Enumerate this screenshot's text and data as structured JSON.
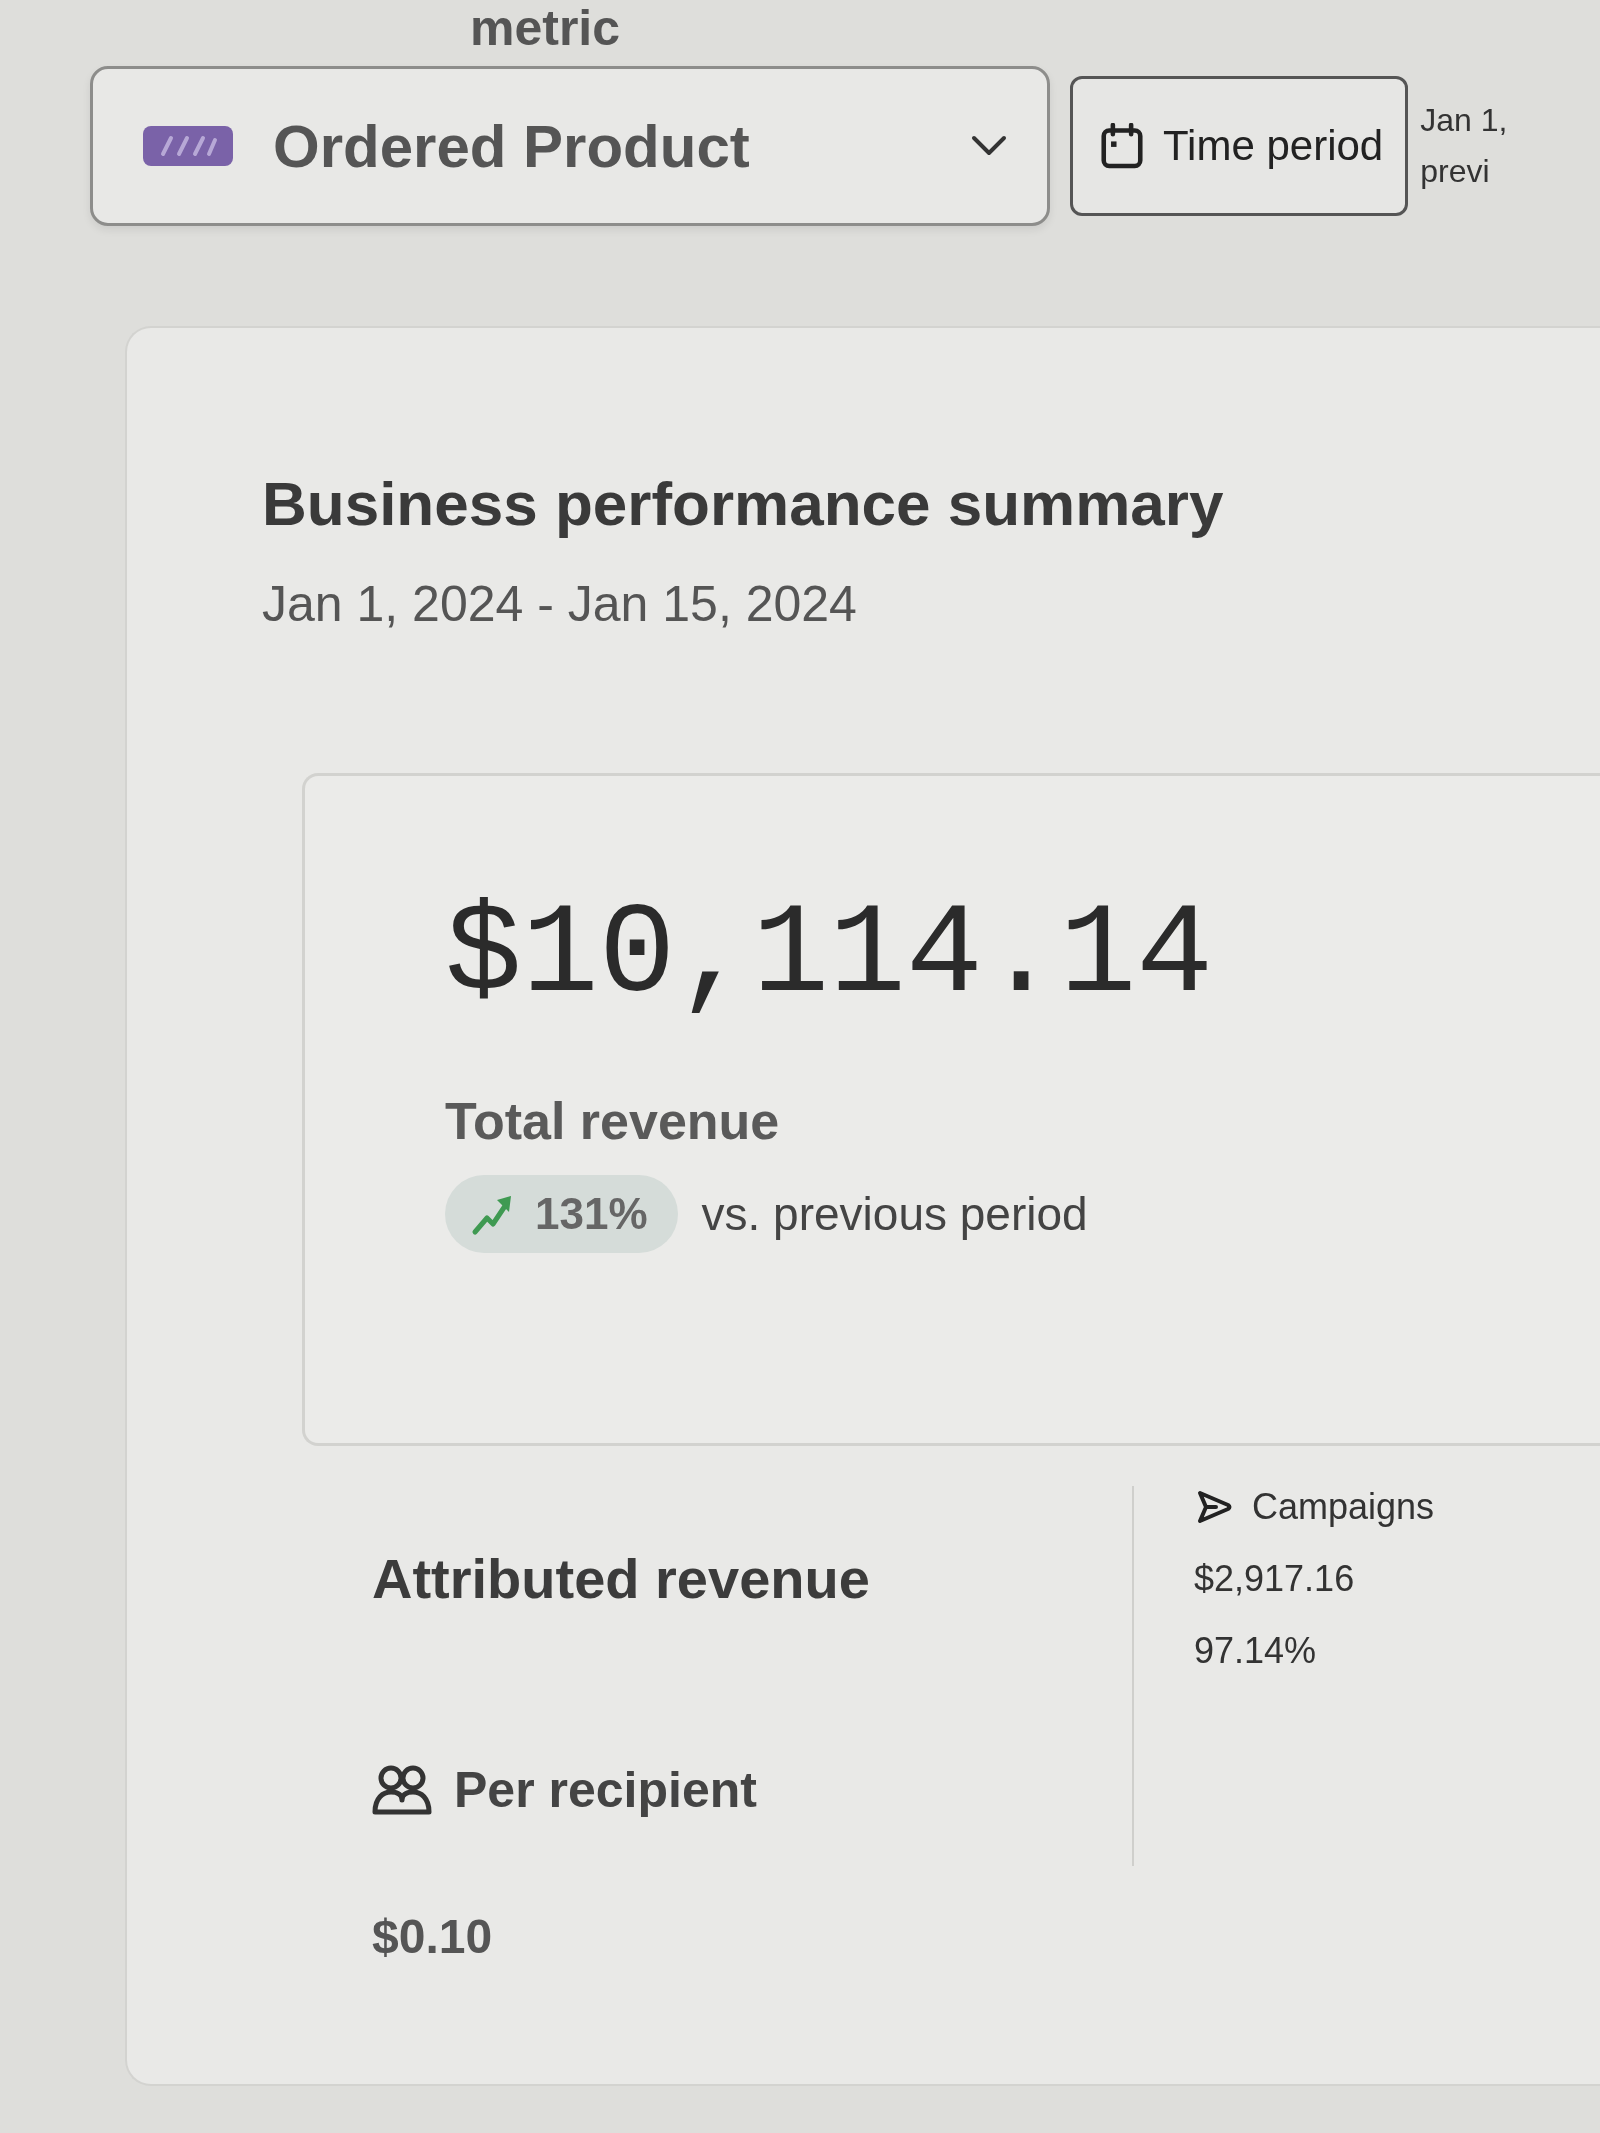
{
  "metric_label": "metric",
  "metric_select": {
    "value": "Ordered Product"
  },
  "time_period_button": {
    "label": "Time period"
  },
  "date_range_preview": {
    "date": "Jan 1,",
    "comparison": "previ"
  },
  "summary": {
    "title": "Business performance summary",
    "date_range": "Jan 1, 2024 - Jan 15, 2024",
    "total": {
      "value": "$10,114.14",
      "label": "Total revenue",
      "change": {
        "value": "131%",
        "increase": true
      },
      "comparison": "vs. previous period"
    },
    "attributed": {
      "title": "Attributed revenue",
      "per_recipient": {
        "label": "Per recipient",
        "value": "$0.10"
      },
      "campaigns": {
        "label": "Campaigns",
        "value": "$2,917.16",
        "share": "97.14%"
      }
    }
  }
}
